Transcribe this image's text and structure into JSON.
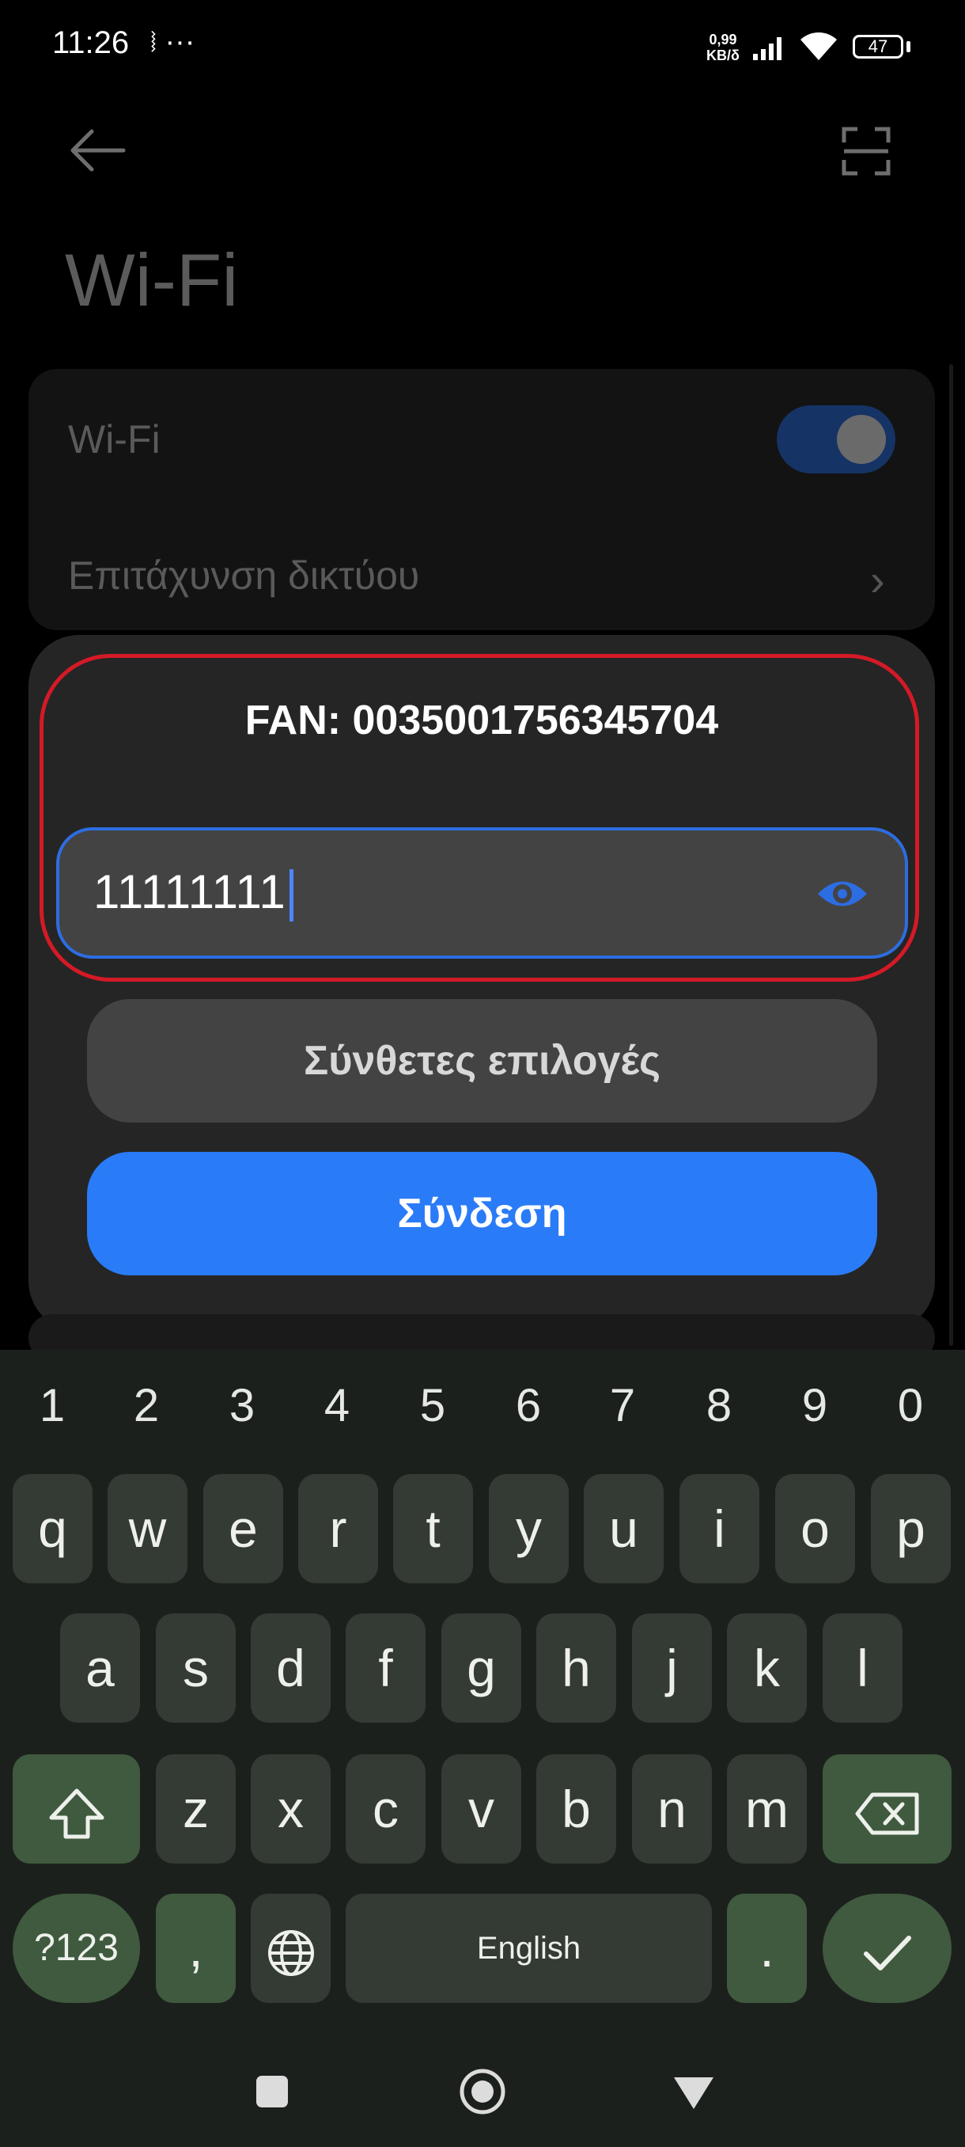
{
  "status_bar": {
    "time": "11:26",
    "left_icons": "⧘ ···",
    "speed_value": "0,99",
    "speed_unit": "KB/δ",
    "battery": "47"
  },
  "header": {
    "title": "Wi-Fi"
  },
  "settings": {
    "wifi_label": "Wi-Fi",
    "wifi_enabled": true,
    "accel_label": "Επιτάχυνση δικτύου"
  },
  "dialog": {
    "title": "FAN: 0035001756345704",
    "password_value": "11111111",
    "advanced_label": "Σύνθετες επιλογές",
    "connect_label": "Σύνδεση"
  },
  "keyboard": {
    "numbers": [
      "1",
      "2",
      "3",
      "4",
      "5",
      "6",
      "7",
      "8",
      "9",
      "0"
    ],
    "row1": [
      "q",
      "w",
      "e",
      "r",
      "t",
      "y",
      "u",
      "i",
      "o",
      "p"
    ],
    "row2": [
      "a",
      "s",
      "d",
      "f",
      "g",
      "h",
      "j",
      "k",
      "l"
    ],
    "row3": [
      "z",
      "x",
      "c",
      "v",
      "b",
      "n",
      "m"
    ],
    "symbols_label": "?123",
    "comma": ",",
    "space_label": "English",
    "period": "."
  },
  "colors": {
    "accent": "#2a7bf7",
    "highlight": "#d41a26",
    "keyboard_bg": "#1c201c",
    "key_bg": "#343a34",
    "key_fn_bg": "#3f5a3e"
  },
  "icons": [
    "back-arrow-icon",
    "scan-icon",
    "eye-icon",
    "shift-icon",
    "backspace-icon",
    "globe-icon",
    "check-icon",
    "recents-icon",
    "home-icon",
    "nav-back-icon",
    "wifi-icon",
    "signal-icon"
  ]
}
